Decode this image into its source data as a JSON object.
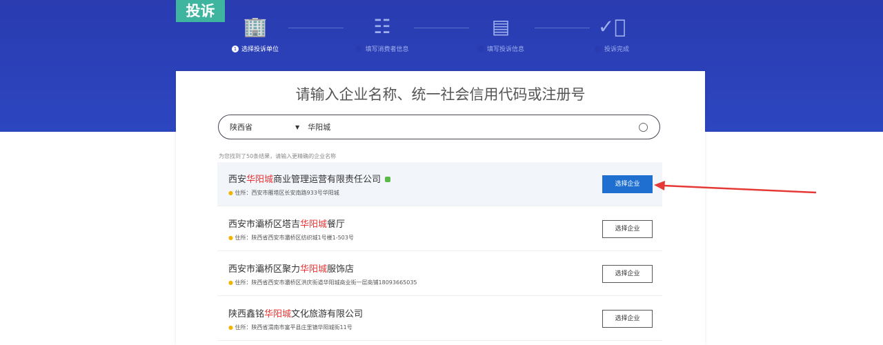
{
  "header": {
    "tag": "投诉"
  },
  "steps": [
    {
      "num": "1",
      "label": "选择投诉单位",
      "icon": "building-search-icon",
      "active": true
    },
    {
      "num": "2",
      "label": "填写消费者信息",
      "icon": "person-document-icon"
    },
    {
      "num": "3",
      "label": "填写投诉信息",
      "icon": "scroll-icon"
    },
    {
      "num": "4",
      "label": "投诉完成",
      "icon": "check-circle-icon"
    }
  ],
  "main": {
    "title": "请输入企业名称、统一社会信用代码或注册号",
    "province": "陕西省",
    "query": "华阳城",
    "hint": "为您找到了50条结果，请输入更精确的企业名称",
    "results": [
      {
        "pre": "西安",
        "kw": "华阳城",
        "post": "商业管理运营有限责任公司",
        "addr_label": "住所：",
        "addr": "西安市雁塔区长安南路933号华阳城",
        "button": "选择企业"
      },
      {
        "pre": "西安市灞桥区塔吉",
        "kw": "华阳城",
        "post": "餐厅",
        "addr_label": "住所：",
        "addr": "陕西省西安市灞桥区纺织城1号楼1-503号",
        "button": "选择企业"
      },
      {
        "pre": "西安市灞桥区聚力",
        "kw": "华阳城",
        "post": "服饰店",
        "addr_label": "住所：",
        "addr": "陕西省西安市灞桥区洪庆街道华阳城商业街一层商铺18093665035",
        "button": "选择企业"
      },
      {
        "pre": "陕西鑫铭",
        "kw": "华阳城",
        "post": "文化旅游有限公司",
        "addr_label": "住所：",
        "addr": "陕西省渭南市富平县庄里镇华阳城街11号",
        "button": "选择企业"
      }
    ]
  },
  "colors": {
    "band": "#2a3bb0",
    "tag": "#3fb5a0",
    "primary": "#1e6fd0",
    "keyword": "#e33333",
    "arrow": "#e53935"
  }
}
